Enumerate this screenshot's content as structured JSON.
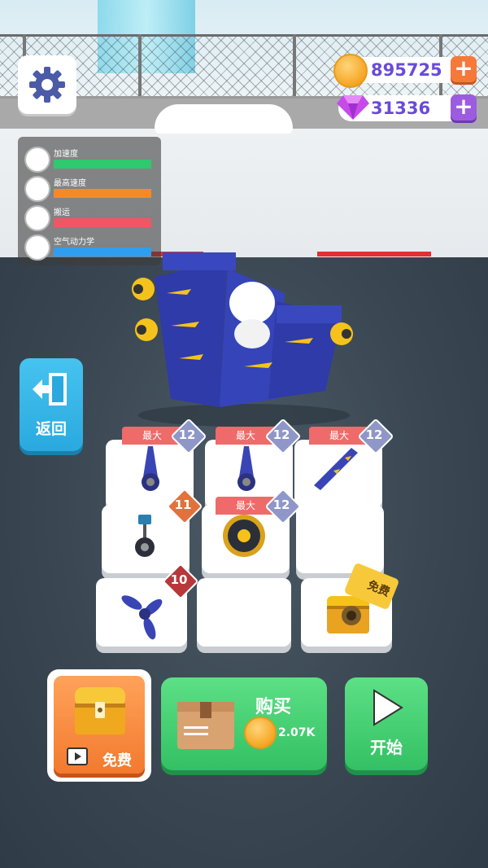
{
  "currency": {
    "coins": "895725",
    "gems": "31336"
  },
  "stats": [
    {
      "label": "加速度",
      "color": "#2fc96f",
      "fill": 0.97
    },
    {
      "label": "最高速度",
      "color": "#f58a24",
      "fill": 0.97
    },
    {
      "label": "搬运",
      "color": "#f05664",
      "fill": 0.97
    },
    {
      "label": "空气动力学",
      "color": "#2f9ef0",
      "fill": 0.97
    }
  ],
  "back_button": {
    "label": "返回"
  },
  "grid": {
    "max_label": "最大",
    "cells": [
      {
        "item": "landing-gear",
        "level": "12",
        "max": true,
        "badge": "blue"
      },
      {
        "item": "landing-gear",
        "level": "12",
        "max": true,
        "badge": "blue"
      },
      {
        "item": "wing",
        "level": "12",
        "max": true,
        "badge": "blue"
      },
      {
        "item": "landing-gear-small",
        "level": "11",
        "max": false,
        "badge": "orange"
      },
      {
        "item": "engine",
        "level": "12",
        "max": true,
        "badge": "blue"
      },
      {
        "item": "empty"
      },
      {
        "item": "propeller",
        "level": "10",
        "max": false,
        "badge": "red"
      },
      {
        "item": "empty"
      },
      {
        "item": "treasure-chest-locked",
        "free_label": "免费"
      }
    ]
  },
  "chest_button": {
    "label": "免费"
  },
  "buy_button": {
    "title": "购买",
    "price": "2.07K"
  },
  "start_button": {
    "label": "开始"
  }
}
